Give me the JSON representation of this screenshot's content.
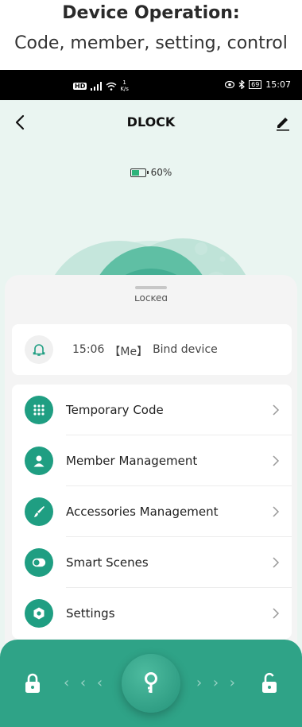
{
  "banner": {
    "title": "Device Operation:",
    "subtitle": "Code, member, setting, control"
  },
  "statusbar": {
    "left_badge": "HD",
    "net_speed": "1",
    "net_unit": "K/s",
    "battery_level": "69",
    "time": "15:07"
  },
  "navbar": {
    "title": "DLOCK"
  },
  "device": {
    "battery_percent": "60%",
    "battery_fraction": 0.6,
    "lock_state": "Locked"
  },
  "log": {
    "time": "15:06",
    "actor": "【Me】",
    "action": "Bind device"
  },
  "menu": [
    {
      "label": "Temporary Code",
      "icon": "keypad-icon"
    },
    {
      "label": "Member Management",
      "icon": "person-icon"
    },
    {
      "label": "Accessories Management",
      "icon": "brush-icon"
    },
    {
      "label": "Smart Scenes",
      "icon": "toggle-icon"
    },
    {
      "label": "Settings",
      "icon": "gear-icon"
    }
  ],
  "control": {
    "left_arrows": "‹ ‹ ‹",
    "right_arrows": "› › ›"
  },
  "colors": {
    "accent": "#1f9e82",
    "control_bar": "#2fa387",
    "background": "#eaf5f1"
  }
}
